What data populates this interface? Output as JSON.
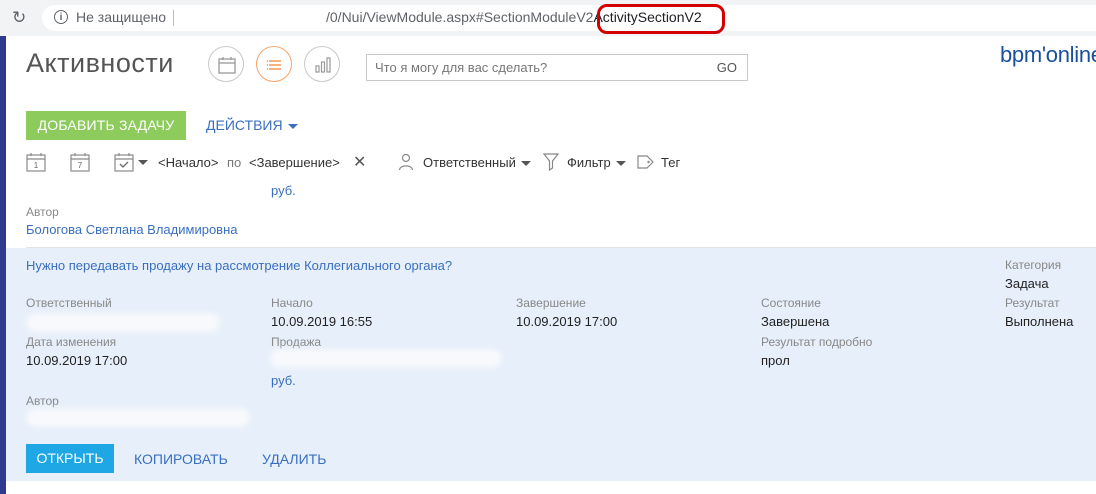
{
  "browser": {
    "security_label": "Не защищено",
    "url_prefix": "/0/Nui/ViewModule.aspx#SectionModuleV2",
    "url_highlight": "ActivitySectionV2"
  },
  "header": {
    "title": "Активности",
    "search_placeholder": "Что я могу для вас сделать?",
    "go_label": "GO",
    "logo": "bpm'online"
  },
  "toolbar": {
    "add_task_label": "ДОБАВИТЬ ЗАДАЧУ",
    "actions_label": "ДЕЙСТВИЯ"
  },
  "filters": {
    "start": "<Начало>",
    "to": "по",
    "end": "<Завершение>",
    "owner": "Ответственный",
    "filter": "Фильтр",
    "tag": "Тег",
    "calendar_day_1": "1",
    "calendar_day_7": "7"
  },
  "prev_item": {
    "currency": "руб.",
    "author_label": "Автор",
    "author_value": "Бологова Светлана Владимировна"
  },
  "card": {
    "title": "Нужно передавать продажу на рассмотрение Коллегиального органа?",
    "owner_label": "Ответственный",
    "start_label": "Начало",
    "start_value": "10.09.2019 16:55",
    "end_label": "Завершение",
    "end_value": "10.09.2019 17:00",
    "state_label": "Состояние",
    "state_value": "Завершена",
    "category_label": "Категория",
    "category_value": "Задача",
    "result_label": "Результат",
    "result_value": "Выполнена",
    "modified_label": "Дата изменения",
    "modified_value": "10.09.2019 17:00",
    "sale_label": "Продажа",
    "sale_currency": "руб.",
    "result_detail_label": "Результат подробно",
    "result_detail_value": "прол",
    "author_label": "Автор",
    "open_label": "ОТКРЫТЬ",
    "copy_label": "КОПИРОВАТЬ",
    "delete_label": "УДАЛИТЬ"
  },
  "colors": {
    "accent_blue": "#3a6fc0",
    "add_button": "#8ecb5d",
    "open_button": "#1ea7e4",
    "card_background": "#e6effa",
    "left_bar": "#2f3a8f",
    "highlight_red": "#d40000"
  }
}
